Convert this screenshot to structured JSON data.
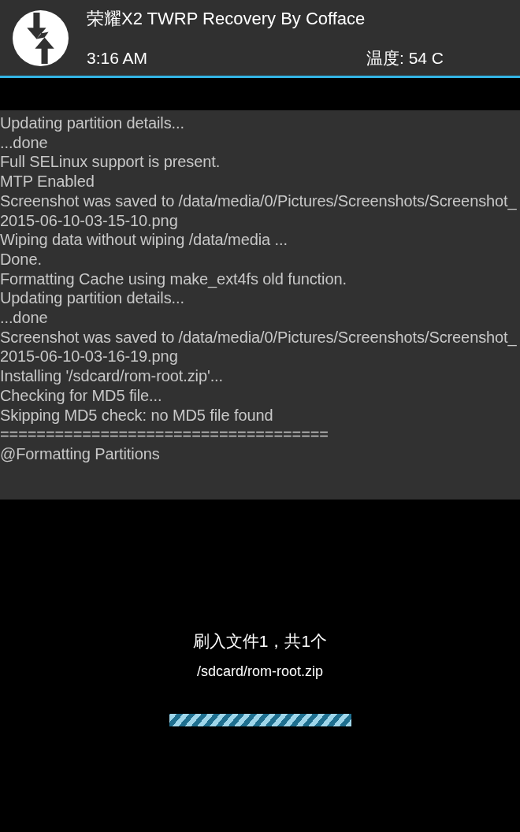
{
  "header": {
    "title": "荣耀X2 TWRP Recovery By Cofface",
    "time": "3:16 AM",
    "temperature": "温度: 54 C"
  },
  "console": {
    "lines": [
      "Updating partition details...",
      "...done",
      "Full SELinux support is present.",
      "MTP Enabled",
      "Screenshot was saved to /data/media/0/Pictures/Screenshots/Screenshot_",
      "2015-06-10-03-15-10.png",
      "Wiping data without wiping /data/media ...",
      "Done.",
      "Formatting Cache using make_ext4fs old function.",
      "Updating partition details...",
      "...done",
      "Screenshot was saved to /data/media/0/Pictures/Screenshots/Screenshot_",
      "2015-06-10-03-16-19.png",
      "Installing '/sdcard/rom-root.zip'...",
      "Checking for MD5 file...",
      "Skipping MD5 check: no MD5 file found",
      "====================================",
      "@Formatting Partitions"
    ]
  },
  "status": {
    "message": "刷入文件1，共1个",
    "file": "/sdcard/rom-root.zip"
  }
}
